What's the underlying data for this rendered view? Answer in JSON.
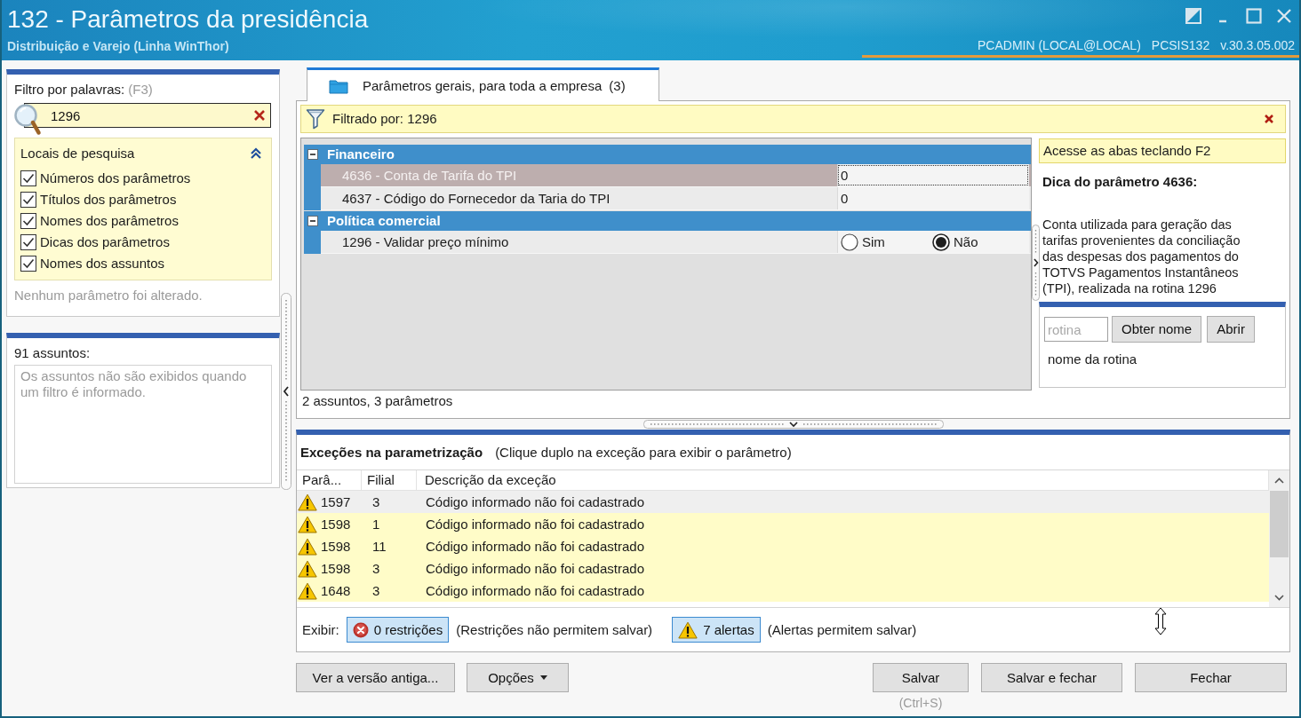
{
  "window": {
    "title": "132 - Parâmetros da presidência",
    "subtitle": "Distribuição e Varejo (Linha WinThor)",
    "user": "PCADMIN (LOCAL@LOCAL)",
    "program": "PCSIS132",
    "version": "v.30.3.05.002"
  },
  "filter_panel": {
    "label": "Filtro por palavras:",
    "shortcut": "(F3)",
    "search": {
      "value": "1296"
    },
    "search_places": {
      "title": "Locais de pesquisa",
      "expanded": true,
      "options": [
        {
          "label": "Números dos parâmetros",
          "checked": true
        },
        {
          "label": "Títulos dos parâmetros",
          "checked": true
        },
        {
          "label": "Nomes dos parâmetros",
          "checked": true
        },
        {
          "label": "Dicas dos parâmetros",
          "checked": true
        },
        {
          "label": "Nomes dos assuntos",
          "checked": true
        }
      ]
    },
    "status": "Nenhum parâmetro foi alterado."
  },
  "subjects_panel": {
    "label": "91 assuntos:",
    "message": "Os assuntos não são exibidos quando um filtro é informado."
  },
  "tabs": [
    {
      "label": "Parâmetros gerais, para toda a empresa",
      "count": "(3)",
      "selected": true
    }
  ],
  "filter_bar": {
    "text": "Filtrado por: 1296"
  },
  "parameter_groups": [
    {
      "title": "Financeiro",
      "expanded": true,
      "parameters": [
        {
          "kind": "text",
          "label": "4636 - Conta de Tarifa do TPI",
          "value": "0",
          "selected": true
        },
        {
          "kind": "text",
          "label": "4637 - Código do Fornecedor da Taria do TPI",
          "value": "0",
          "selected": false
        }
      ]
    },
    {
      "title": "Política comercial",
      "expanded": true,
      "parameters": [
        {
          "kind": "radio",
          "label": "1296 - Validar preço mínimo",
          "selected": false,
          "options": [
            {
              "label": "Sim",
              "selected": false
            },
            {
              "label": "Não",
              "selected": true
            }
          ]
        }
      ]
    }
  ],
  "grid_summary": "2 assuntos, 3 parâmetros",
  "hint_panel": {
    "banner": "Acesse as abas teclando F2",
    "title": "Dica do parâmetro 4636:",
    "text": "Conta utilizada para geração das tarifas provenientes da conciliação das despesas dos pagamentos do TOTVS Pagamentos Instantâneos (TPI), realizada na rotina 1296"
  },
  "routine_panel": {
    "placeholder": "rotina",
    "buttons": [
      "Obter nome",
      "Abrir"
    ],
    "name": "nome da rotina"
  },
  "exceptions": {
    "title": "Exceções na parametrização",
    "note": "(Clique duplo na exceção para exibir o parâmetro)",
    "columns": [
      "Parâ...",
      "Filial",
      "Descrição da exceção"
    ],
    "rows": [
      {
        "kind": "alert",
        "param": "1597",
        "branch": "3",
        "description": "Código informado não foi cadastrado",
        "selected": true
      },
      {
        "kind": "alert",
        "param": "1598",
        "branch": "1",
        "description": "Código informado não foi cadastrado",
        "selected": false
      },
      {
        "kind": "alert",
        "param": "1598",
        "branch": "11",
        "description": "Código informado não foi cadastrado",
        "selected": false
      },
      {
        "kind": "alert",
        "param": "1598",
        "branch": "3",
        "description": "Código informado não foi cadastrado",
        "selected": false
      },
      {
        "kind": "alert",
        "param": "1648",
        "branch": "3",
        "description": "Código informado não foi cadastrado",
        "selected": false
      }
    ],
    "show_label": "Exibir:",
    "filters": [
      {
        "kind": "restriction",
        "label": "0 restrições",
        "note": "(Restrições não permitem salvar)",
        "on": true
      },
      {
        "kind": "alert",
        "label": "7 alertas",
        "note": "(Alertas permitem salvar)",
        "on": true
      }
    ]
  },
  "footer": {
    "left_buttons": [
      {
        "kind": "plain",
        "label": "Ver a versão antiga..."
      },
      {
        "kind": "dropdown",
        "label": "Opções"
      }
    ],
    "right_buttons": [
      {
        "label": "Salvar",
        "shortcut": "(Ctrl+S)"
      },
      {
        "label": "Salvar e fechar"
      },
      {
        "label": "Fechar"
      }
    ]
  }
}
